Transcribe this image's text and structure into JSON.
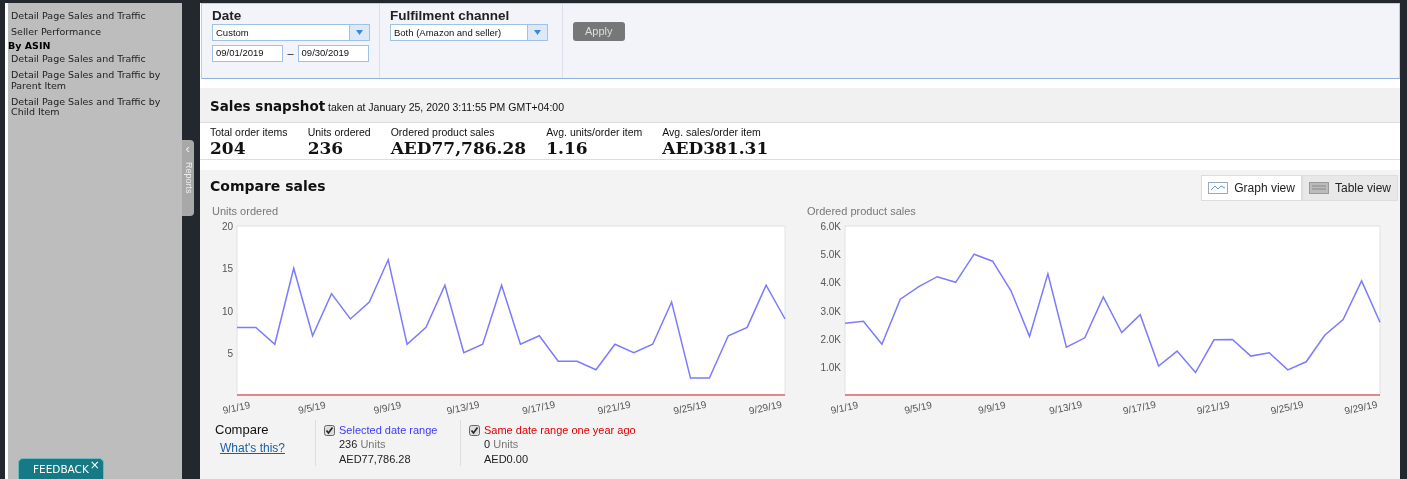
{
  "sidebar": {
    "items": [
      {
        "kind": "link",
        "label": "Detail Page Sales and Traffic"
      },
      {
        "kind": "link",
        "label": "Seller Performance"
      },
      {
        "kind": "heading",
        "label": "By ASIN"
      },
      {
        "kind": "link",
        "label": "Detail Page Sales and Traffic"
      },
      {
        "kind": "link",
        "label": "Detail Page Sales and Traffic by Parent Item"
      },
      {
        "kind": "link",
        "label": "Detail Page Sales and Traffic by Child Item"
      }
    ],
    "collapse_tab": {
      "arrow": "‹",
      "label": "Reports"
    }
  },
  "feedback": {
    "label": "FEEDBACK",
    "close": "×"
  },
  "filters": {
    "date": {
      "label": "Date",
      "select": "Custom",
      "from": "09/01/2019",
      "separator": "–",
      "to": "09/30/2019"
    },
    "fulfilment": {
      "label": "Fulfilment channel",
      "select": "Both (Amazon and seller)"
    },
    "apply": {
      "label": "Apply",
      "disabled": true
    }
  },
  "snapshot": {
    "title": "Sales snapshot",
    "subtitle": "taken at January 25, 2020 3:11:55 PM GMT+04:00",
    "metrics": [
      {
        "label": "Total order items",
        "value": "204"
      },
      {
        "label": "Units ordered",
        "value": "236"
      },
      {
        "label": "Ordered product sales",
        "value": "AED77,786.28"
      },
      {
        "label": "Avg. units/order item",
        "value": "1.16"
      },
      {
        "label": "Avg. sales/order item",
        "value": "AED381.31"
      }
    ]
  },
  "compare": {
    "title": "Compare sales",
    "views": [
      {
        "label": "Graph view",
        "selected": true
      },
      {
        "label": "Table view",
        "selected": false
      }
    ],
    "charts": [
      {
        "chart_data": {
          "type": "line",
          "title": "Units ordered",
          "categories": [
            "9/1/19",
            null,
            null,
            null,
            "9/5/19",
            null,
            null,
            null,
            "9/9/19",
            null,
            null,
            null,
            "9/13/19",
            null,
            null,
            null,
            "9/17/19",
            null,
            null,
            null,
            "9/21/19",
            null,
            null,
            null,
            "9/25/19",
            null,
            null,
            null,
            "9/29/19",
            null
          ],
          "series": [
            {
              "color": "#7b7bff",
              "values": [
                8,
                8,
                6,
                15,
                7,
                12,
                9,
                11,
                16,
                6,
                8,
                13,
                5,
                6,
                13,
                6,
                7,
                4,
                4,
                3,
                6,
                5,
                6,
                11,
                2,
                2,
                7,
                8,
                13,
                9
              ]
            },
            {
              "color": "#e06666",
              "values": [
                0,
                0,
                0,
                0,
                0,
                0,
                0,
                0,
                0,
                0,
                0,
                0,
                0,
                0,
                0,
                0,
                0,
                0,
                0,
                0,
                0,
                0,
                0,
                0,
                0,
                0,
                0,
                0,
                0,
                0
              ]
            }
          ],
          "ylim": [
            0,
            20
          ],
          "yticks": [
            5,
            10,
            15,
            20
          ]
        }
      },
      {
        "chart_data": {
          "type": "line",
          "title": "Ordered product sales",
          "categories": [
            "9/1/19",
            null,
            null,
            null,
            "9/5/19",
            null,
            null,
            null,
            "9/9/19",
            null,
            null,
            null,
            "9/13/19",
            null,
            null,
            null,
            "9/17/19",
            null,
            null,
            null,
            "9/21/19",
            null,
            null,
            null,
            "9/25/19",
            null,
            null,
            null,
            "9/29/19",
            null
          ],
          "series": [
            {
              "color": "#7b7bff",
              "values": [
                2550,
                2620,
                1800,
                3400,
                3850,
                4200,
                4000,
                5000,
                4750,
                3700,
                2080,
                4300,
                1700,
                2030,
                3480,
                2220,
                2850,
                1030,
                1560,
                800,
                1960,
                1970,
                1380,
                1500,
                890,
                1180,
                2120,
                2680,
                4050,
                2580
              ]
            },
            {
              "color": "#e06666",
              "values": [
                0,
                0,
                0,
                0,
                0,
                0,
                0,
                0,
                0,
                0,
                0,
                0,
                0,
                0,
                0,
                0,
                0,
                0,
                0,
                0,
                0,
                0,
                0,
                0,
                0,
                0,
                0,
                0,
                0,
                0
              ]
            }
          ],
          "ylim": [
            0,
            6000
          ],
          "yticks": [
            {
              "value": 1000,
              "label": "1.0K"
            },
            {
              "value": 2000,
              "label": "2.0K"
            },
            {
              "value": 3000,
              "label": "3.0K"
            },
            {
              "value": 4000,
              "label": "4.0K"
            },
            {
              "value": 5000,
              "label": "5.0K"
            },
            {
              "value": 6000,
              "label": "6.0K"
            }
          ]
        }
      }
    ],
    "legend": {
      "title": "Compare",
      "link": "What's this?",
      "items": [
        {
          "label": "Selected date range",
          "checked": true,
          "color": "#3b3bff",
          "units": "236",
          "units_label": "Units",
          "sales": "AED77,786.28"
        },
        {
          "label": "Same date range one year ago",
          "checked": true,
          "color": "#e00000",
          "units": "0",
          "units_label": "Units",
          "sales": "AED0.00"
        }
      ]
    }
  }
}
